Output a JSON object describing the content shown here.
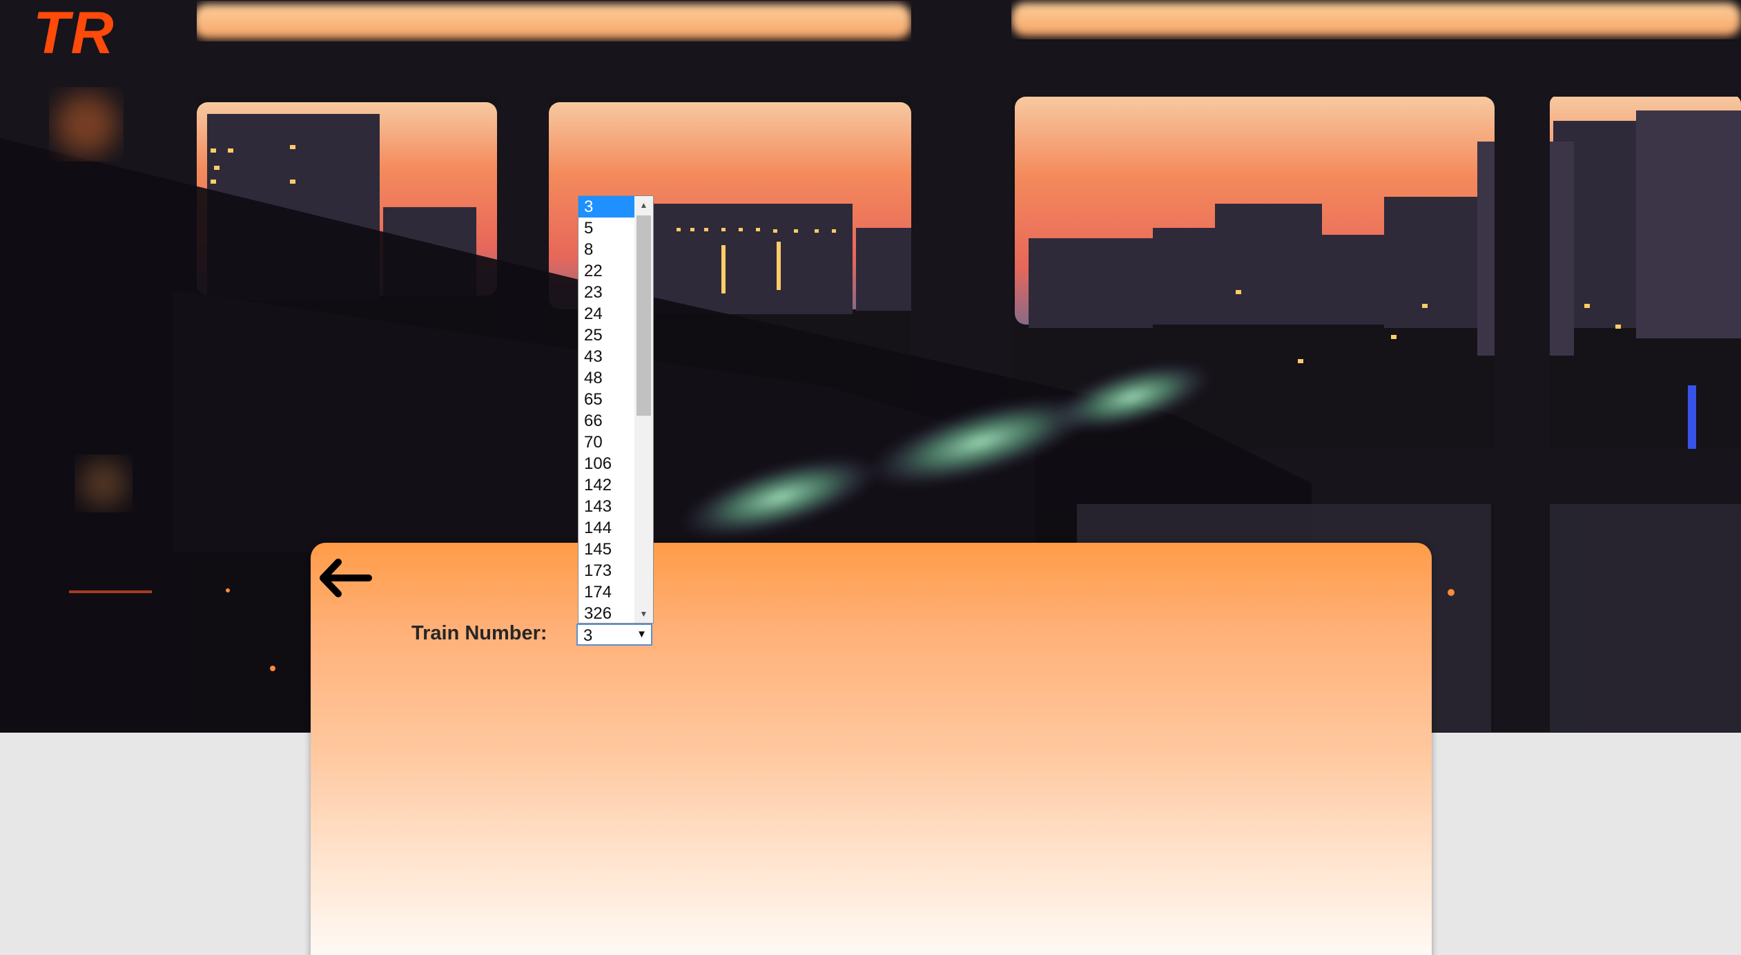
{
  "brand": {
    "logo_text": "TR",
    "logo_color": "#ff4a0a"
  },
  "background": {
    "description_icon": "city-sunset-image"
  },
  "form": {
    "back_icon": "arrow-left-icon",
    "train_number_label": "Train Number:",
    "train_number_selected": "3",
    "train_number_options": [
      "3",
      "5",
      "8",
      "22",
      "23",
      "24",
      "25",
      "43",
      "48",
      "65",
      "66",
      "70",
      "106",
      "142",
      "143",
      "144",
      "145",
      "173",
      "174",
      "326"
    ]
  },
  "colors": {
    "card_top": "#ff9c48",
    "card_bottom": "#fffdfb",
    "selection_highlight": "#1e90ff",
    "page_background": "#e8e7e8"
  }
}
